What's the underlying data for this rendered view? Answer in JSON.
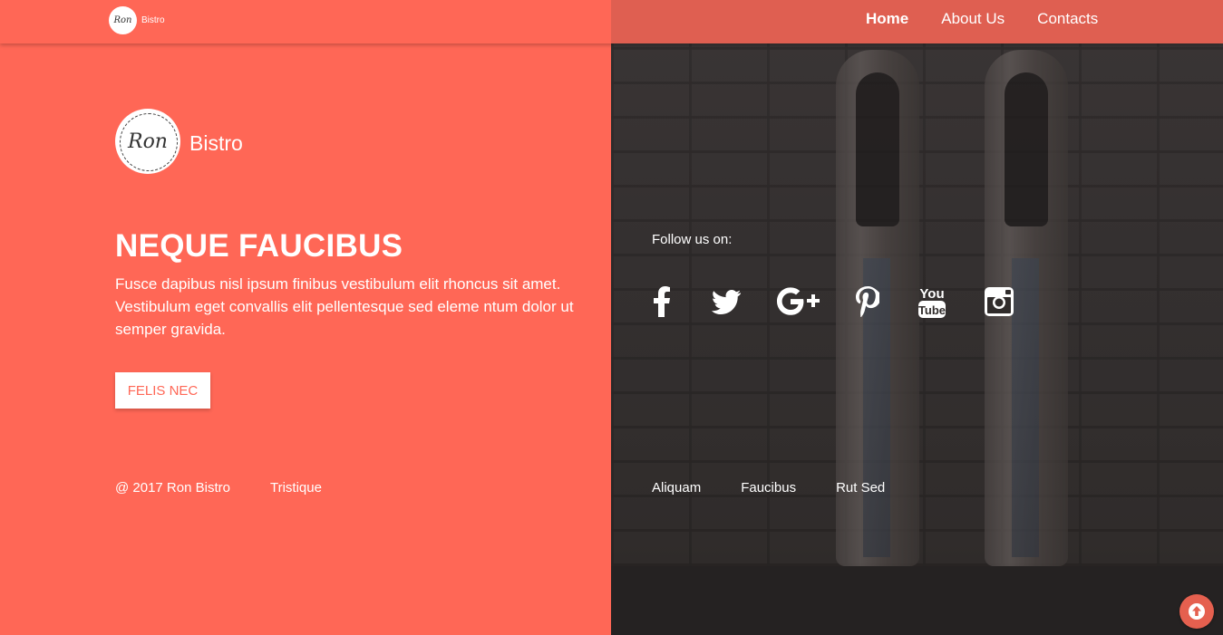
{
  "header": {
    "logo_text": "Ron",
    "brand_name": "Bistro",
    "nav": [
      {
        "label": "Home"
      },
      {
        "label": "About Us"
      },
      {
        "label": "Contacts"
      }
    ]
  },
  "hero": {
    "logo_text": "Ron",
    "brand_name": "Bistro",
    "title": "NEQUE FAUCIBUS",
    "description": "Fusce dapibus nisl ipsum finibus vestibulum elit rhoncus sit amet. Vestibulum eget convallis elit pellentesque sed eleme ntum dolor ut semper gravida.",
    "button_label": "FELIS NEC"
  },
  "footer_left": {
    "copyright": "@ 2017 Ron Bistro",
    "link": "Tristique"
  },
  "social": {
    "label": "Follow us on:",
    "icons": [
      "facebook-icon",
      "twitter-icon",
      "google-plus-icon",
      "pinterest-icon",
      "youtube-icon",
      "instagram-icon"
    ]
  },
  "footer_right": {
    "links": [
      "Aliquam",
      "Faucibus",
      "Rut Sed"
    ]
  },
  "colors": {
    "accent": "#ff6756",
    "header_right": "#df5f51",
    "scroll_button": "#e5604f",
    "dark_panel": "#302c2b"
  }
}
